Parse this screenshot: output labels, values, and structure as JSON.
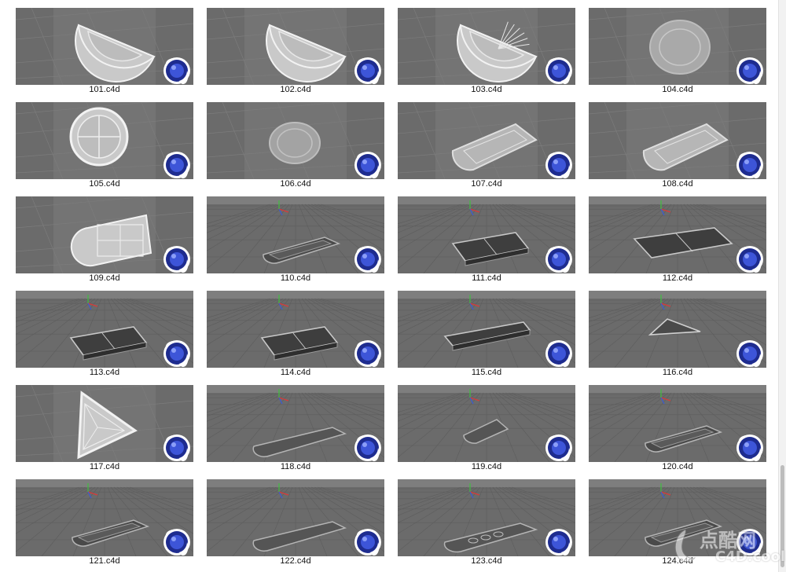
{
  "files": [
    {
      "name": "101.c4d",
      "view": "top",
      "shape": "half-disc"
    },
    {
      "name": "102.c4d",
      "view": "top",
      "shape": "half-disc"
    },
    {
      "name": "103.c4d",
      "view": "top",
      "shape": "half-disc-rays"
    },
    {
      "name": "104.c4d",
      "view": "top",
      "shape": "disc-flat"
    },
    {
      "name": "105.c4d",
      "view": "top",
      "shape": "disc-cross"
    },
    {
      "name": "106.c4d",
      "view": "top",
      "shape": "disc-small"
    },
    {
      "name": "107.c4d",
      "view": "top",
      "shape": "arch-panel"
    },
    {
      "name": "108.c4d",
      "view": "top",
      "shape": "arch-panel"
    },
    {
      "name": "109.c4d",
      "view": "top",
      "shape": "arch-grid"
    },
    {
      "name": "110.c4d",
      "view": "perspective",
      "shape": "arch-slab"
    },
    {
      "name": "111.c4d",
      "view": "perspective",
      "shape": "tray"
    },
    {
      "name": "112.c4d",
      "view": "perspective",
      "shape": "tray-wide"
    },
    {
      "name": "113.c4d",
      "view": "perspective",
      "shape": "tray"
    },
    {
      "name": "114.c4d",
      "view": "perspective",
      "shape": "tray"
    },
    {
      "name": "115.c4d",
      "view": "perspective",
      "shape": "tray-long"
    },
    {
      "name": "116.c4d",
      "view": "perspective",
      "shape": "triangle-slab"
    },
    {
      "name": "117.c4d",
      "view": "top",
      "shape": "triangle"
    },
    {
      "name": "118.c4d",
      "view": "perspective",
      "shape": "arch-slab-long"
    },
    {
      "name": "119.c4d",
      "view": "perspective",
      "shape": "arch-slab-small"
    },
    {
      "name": "120.c4d",
      "view": "perspective",
      "shape": "arch-slab"
    },
    {
      "name": "121.c4d",
      "view": "perspective",
      "shape": "arch-slab"
    },
    {
      "name": "122.c4d",
      "view": "perspective",
      "shape": "arch-slab-long"
    },
    {
      "name": "123.c4d",
      "view": "perspective",
      "shape": "arch-slab-dots"
    },
    {
      "name": "124.c4d",
      "view": "perspective",
      "shape": "arch-slab"
    }
  ],
  "watermark": {
    "cn": "点酷网",
    "en": "C4D.cool"
  },
  "colors": {
    "viewport": "#6b6b6b",
    "viewport_light": "#8a8a8a",
    "model": "#c9c9c9",
    "model_edge": "#f2f2f2",
    "cinema4d_blue": "#1e2c8f",
    "page_bg": "#ffffff"
  }
}
